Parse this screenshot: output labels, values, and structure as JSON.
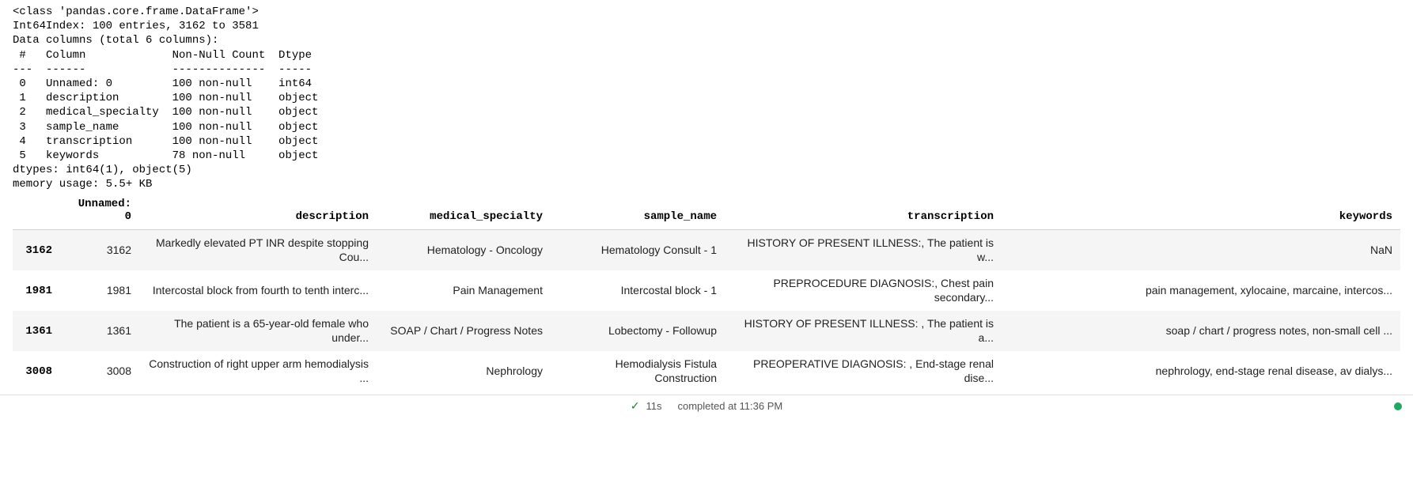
{
  "info_text": "<class 'pandas.core.frame.DataFrame'>\nInt64Index: 100 entries, 3162 to 3581\nData columns (total 6 columns):\n #   Column             Non-Null Count  Dtype \n---  ------             --------------  ----- \n 0   Unnamed: 0         100 non-null    int64 \n 1   description        100 non-null    object\n 2   medical_specialty  100 non-null    object\n 3   sample_name        100 non-null    object\n 4   transcription      100 non-null    object\n 5   keywords           78 non-null     object\ndtypes: int64(1), object(5)\nmemory usage: 5.5+ KB",
  "table": {
    "columns": {
      "index": "",
      "unnamed": "Unnamed: 0",
      "description": "description",
      "medical_specialty": "medical_specialty",
      "sample_name": "sample_name",
      "transcription": "transcription",
      "keywords": "keywords"
    },
    "rows": [
      {
        "index": "3162",
        "unnamed": "3162",
        "description": "Markedly elevated PT INR despite stopping Cou...",
        "medical_specialty": "Hematology - Oncology",
        "sample_name": "Hematology Consult - 1",
        "transcription": "HISTORY OF PRESENT ILLNESS:, The patient is w...",
        "keywords": "NaN"
      },
      {
        "index": "1981",
        "unnamed": "1981",
        "description": "Intercostal block from fourth to tenth interc...",
        "medical_specialty": "Pain Management",
        "sample_name": "Intercostal block - 1",
        "transcription": "PREPROCEDURE DIAGNOSIS:, Chest pain secondary...",
        "keywords": "pain management, xylocaine, marcaine, intercos..."
      },
      {
        "index": "1361",
        "unnamed": "1361",
        "description": "The patient is a 65-year-old female who under...",
        "medical_specialty": "SOAP / Chart / Progress Notes",
        "sample_name": "Lobectomy - Followup",
        "transcription": "HISTORY OF PRESENT ILLNESS: , The patient is a...",
        "keywords": "soap / chart / progress notes, non-small cell ..."
      },
      {
        "index": "3008",
        "unnamed": "3008",
        "description": "Construction of right upper arm hemodialysis ...",
        "medical_specialty": "Nephrology",
        "sample_name": "Hemodialysis Fistula Construction",
        "transcription": "PREOPERATIVE DIAGNOSIS: , End-stage renal dise...",
        "keywords": "nephrology, end-stage renal disease, av dialys..."
      }
    ]
  },
  "status": {
    "duration": "11s",
    "completed": "completed at 11:36 PM"
  }
}
